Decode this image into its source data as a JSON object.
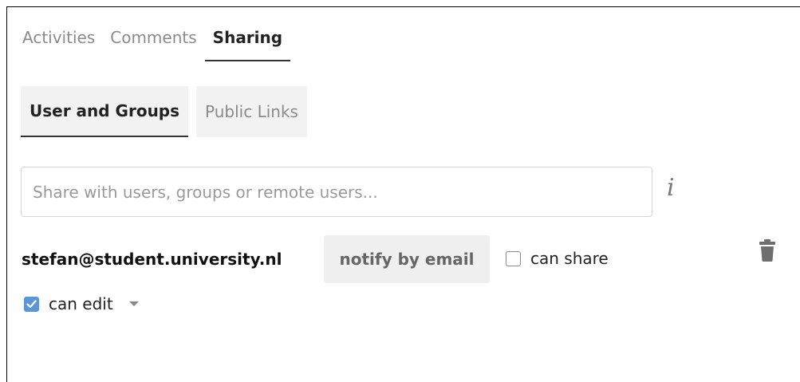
{
  "top_tabs": {
    "activities": "Activities",
    "comments": "Comments",
    "sharing": "Sharing"
  },
  "sub_tabs": {
    "users_groups": "User and Groups",
    "public_links": "Public Links"
  },
  "search": {
    "placeholder": "Share with users, groups or remote users..."
  },
  "info_glyph": "i",
  "share_entry": {
    "user": "stefan@student.university.nl",
    "notify_label": "notify by email",
    "can_share_label": "can share",
    "can_share_checked": false,
    "can_edit_label": "can edit",
    "can_edit_checked": true
  },
  "icons": {
    "info": "info-icon",
    "delete": "trash-icon",
    "dropdown": "caret-down-icon",
    "check": "check-icon"
  },
  "colors": {
    "checkbox_checked": "#5a97d4",
    "active_underline": "#333333",
    "tab_background": "#f2f2f2"
  }
}
